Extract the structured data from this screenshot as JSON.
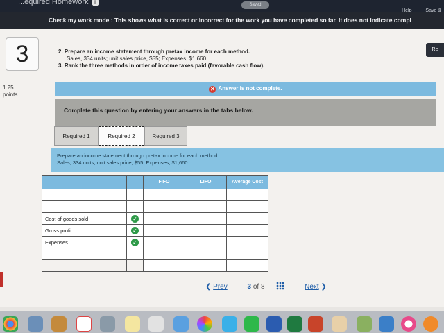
{
  "topbar": {
    "title": "...equired Homework",
    "badge": "i",
    "saved": "Saved",
    "help": "Help",
    "save_exit": "Save &"
  },
  "check_mode": "Check my work mode : This shows what is correct or incorrect for the work you have completed so far. It does not indicate compl",
  "question": {
    "number": "3",
    "points_value": "1.25",
    "points_label": "points",
    "re_button": "Re",
    "line1": "2. Prepare an income statement through pretax income for each method.",
    "line2": "Sales, 334 units; unit sales price, $55; Expenses, $1,660",
    "line3": "3. Rank the three methods in order of income taxes paid (favorable cash flow)."
  },
  "status": {
    "icon": "x-circle-icon",
    "text": "Answer is not complete."
  },
  "complete_prompt": "Complete this question by entering your answers in the tabs below.",
  "tabs": [
    {
      "label": "Required 1"
    },
    {
      "label": "Required 2"
    },
    {
      "label": "Required 3"
    }
  ],
  "active_tab": "Required 2",
  "prompt": {
    "line1": "Prepare an income statement through pretax income for each method.",
    "line2": "Sales, 334 units; unit sales price, $55; Expenses, $1,660"
  },
  "table": {
    "headers": [
      "FIFO",
      "LIFO",
      "Average Cost"
    ],
    "rows": [
      {
        "label": "",
        "check": false
      },
      {
        "label": "",
        "check": false
      },
      {
        "label": "Cost of goods sold",
        "check": true
      },
      {
        "label": "Gross profit",
        "check": true
      },
      {
        "label": "Expenses",
        "check": true
      },
      {
        "label": "",
        "check": false
      }
    ]
  },
  "pager": {
    "prev": "Prev",
    "current": "3",
    "of": "of 8",
    "next": "Next"
  },
  "colors": {
    "accent": "#7cbadf",
    "error": "#d63a2f",
    "ok": "#2e9a48",
    "link": "#1f5ea8"
  }
}
